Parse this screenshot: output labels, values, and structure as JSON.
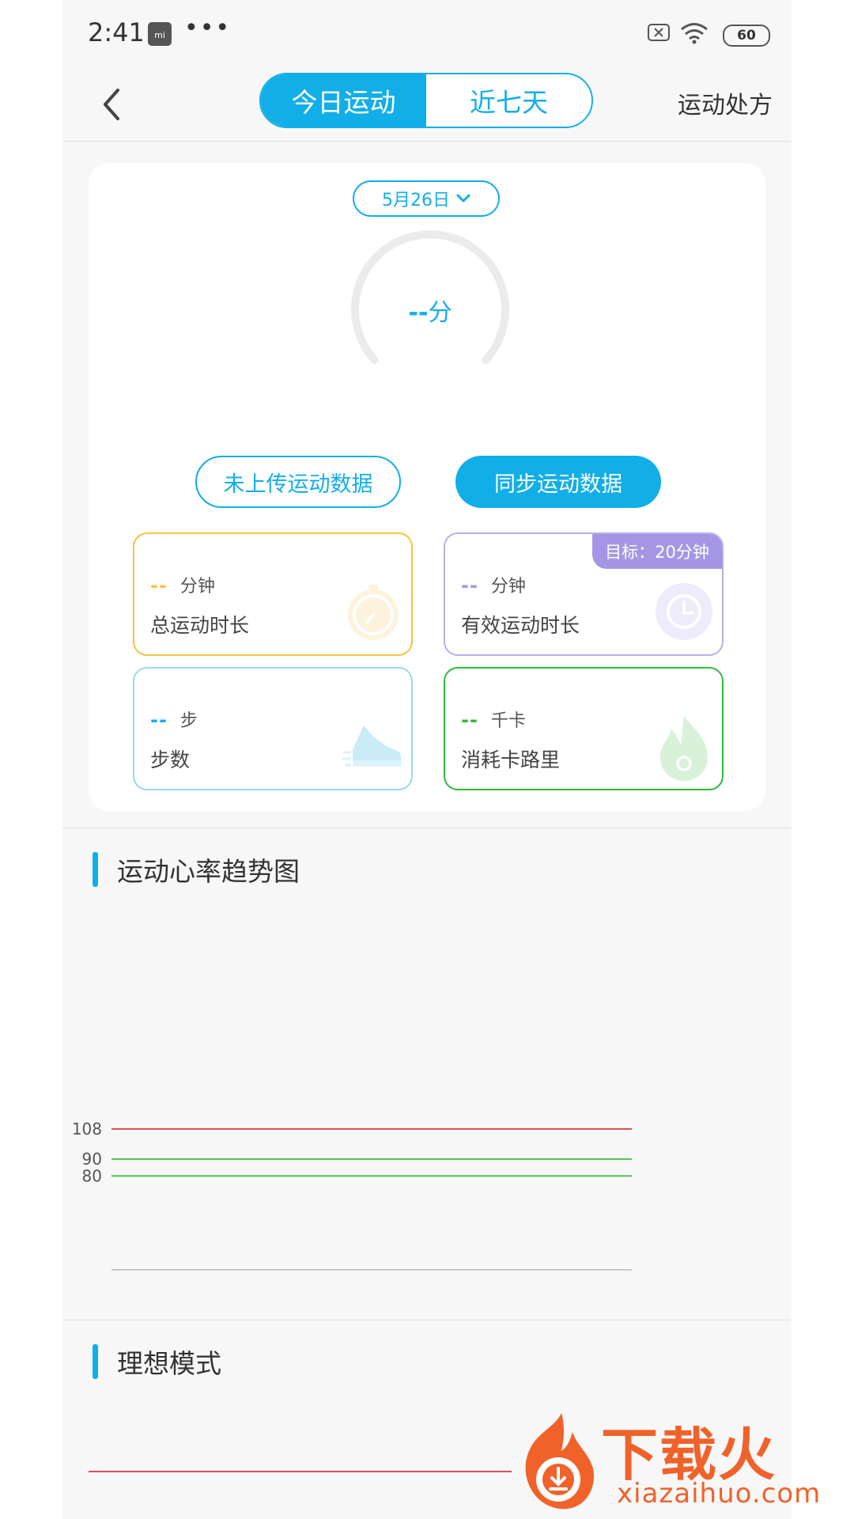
{
  "colors": {
    "accent": "#12aee8",
    "limit_red": "#e05050",
    "zone_green": "#4cc14f",
    "axis_gray": "#c8c8c8"
  },
  "status_bar": {
    "time": "2:41",
    "app_badge": "mi",
    "dots": "•••",
    "battery": "60",
    "icons": [
      "mi-app-icon",
      "wifi-icon",
      "sim-off-icon",
      "battery-icon"
    ]
  },
  "nav": {
    "tabs": [
      {
        "label": "今日运动",
        "active": true
      },
      {
        "label": "近七天",
        "active": false
      }
    ],
    "right_action": "运动处方",
    "back_icon": "chevron-left-icon"
  },
  "summary": {
    "date": "5月26日",
    "gauge": {
      "value": "--",
      "unit": "分"
    },
    "buttons": {
      "upload": "未上传运动数据",
      "sync": "同步运动数据"
    },
    "tiles": [
      {
        "value": "--",
        "unit": "分钟",
        "label": "总运动时长",
        "color": "#f5c342",
        "icon": "stopwatch-icon"
      },
      {
        "value": "--",
        "unit": "分钟",
        "label": "有效运动时长",
        "color": "#a596e5",
        "icon": "clock-icon",
        "goal": "目标：20分钟"
      },
      {
        "value": "--",
        "unit": "步",
        "label": "步数",
        "color": "#12aee8",
        "icon": "sneaker-icon"
      },
      {
        "value": "--",
        "unit": "千卡",
        "label": "消耗卡路里",
        "color": "#2dbb3a",
        "icon": "flame-icon"
      }
    ]
  },
  "heart_rate": {
    "title": "运动心率趋势图",
    "chart_data": {
      "type": "line",
      "series": [],
      "reference_lines": [
        {
          "value": 108,
          "color": "#e05050"
        },
        {
          "value": 90,
          "color": "#4cc14f"
        },
        {
          "value": 80,
          "color": "#4cc14f"
        }
      ],
      "tick_labels": [
        "108",
        "90",
        "80"
      ],
      "grid": false
    }
  },
  "ideal_mode": {
    "title": "理想模式"
  },
  "watermark": {
    "name": "下载火",
    "url": "xiazaihuo.com"
  }
}
